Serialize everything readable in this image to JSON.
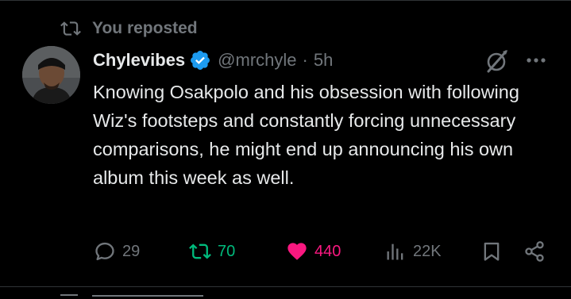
{
  "repost": {
    "label": "You reposted"
  },
  "tweet": {
    "display_name": "Chylevibes",
    "handle": "@mrchyle",
    "separator": "·",
    "time": "5h",
    "text": "Knowing Osakpolo and his obsession with following Wiz's footsteps and constantly forcing unnecessary comparisons, he might end up announcing his own album this week as well."
  },
  "actions": {
    "replies": "29",
    "reposts": "70",
    "likes": "440",
    "views": "22K"
  },
  "icons": {
    "repost": "repost-icon",
    "verified": "verified-badge-icon",
    "grok": "grok-icon",
    "more": "more-options-icon",
    "reply": "reply-icon",
    "retweet": "retweet-icon",
    "like": "heart-icon",
    "views": "views-icon",
    "bookmark": "bookmark-icon",
    "share": "share-icon"
  },
  "colors": {
    "background": "#000000",
    "text": "#e7e9ea",
    "muted": "#71767b",
    "verified": "#1d9bf0",
    "retweet": "#00ba7c",
    "like": "#f91880"
  }
}
